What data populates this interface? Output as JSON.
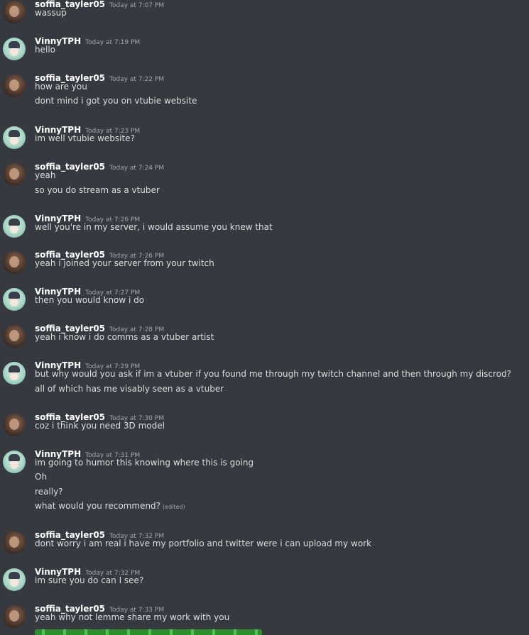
{
  "messages": [
    {
      "user": "soffia_tayler05",
      "time": "Today at 7:07 PM",
      "lines": [
        "wassup"
      ]
    },
    {
      "user": "VinnyTPH",
      "time": "Today at 7:19 PM",
      "lines": [
        "hello"
      ]
    },
    {
      "user": "soffia_tayler05",
      "time": "Today at 7:22 PM",
      "lines": [
        "how are you",
        "dont mind i got you on vtubie website"
      ]
    },
    {
      "user": "VinnyTPH",
      "time": "Today at 7:23 PM",
      "lines": [
        "im well vtubie website?"
      ]
    },
    {
      "user": "soffia_tayler05",
      "time": "Today at 7:24 PM",
      "lines": [
        "yeah",
        "so you do stream as a vtuber"
      ]
    },
    {
      "user": "VinnyTPH",
      "time": "Today at 7:26 PM",
      "lines": [
        "well you're in my server, i would assume you knew that"
      ]
    },
    {
      "user": "soffia_tayler05",
      "time": "Today at 7:26 PM",
      "lines": [
        "yeah i joined your server from your twitch"
      ]
    },
    {
      "user": "VinnyTPH",
      "time": "Today at 7:27 PM",
      "lines": [
        "then you would know i do"
      ]
    },
    {
      "user": "soffia_tayler05",
      "time": "Today at 7:28 PM",
      "lines": [
        "yeah i know  i do comms as a vtuber artist"
      ]
    },
    {
      "user": "VinnyTPH",
      "time": "Today at 7:29 PM",
      "lines": [
        "but why would you ask if im a vtuber if you found me through my twitch channel and then through my discrod?",
        "all of which has me visably seen as a vtuber"
      ]
    },
    {
      "user": "soffia_tayler05",
      "time": "Today at 7:30 PM",
      "lines": [
        "coz i think you need 3D model"
      ]
    },
    {
      "user": "VinnyTPH",
      "time": "Today at 7:31 PM",
      "lines": [
        "im going to humor this knowing where this is going",
        "Oh",
        "really?",
        "what would you recommend?"
      ],
      "edited": "(edited)"
    },
    {
      "user": "soffia_tayler05",
      "time": "Today at 7:32 PM",
      "lines": [
        "dont worry i am real i have my portfolio and twitter were i can upload my work"
      ]
    },
    {
      "user": "VinnyTPH",
      "time": "Today at 7:32 PM",
      "lines": [
        "im sure you do can I see?"
      ]
    },
    {
      "user": "soffia_tayler05",
      "time": "Today at 7:33 PM",
      "lines": [
        "yeah why not lemme share my work with you"
      ]
    }
  ]
}
